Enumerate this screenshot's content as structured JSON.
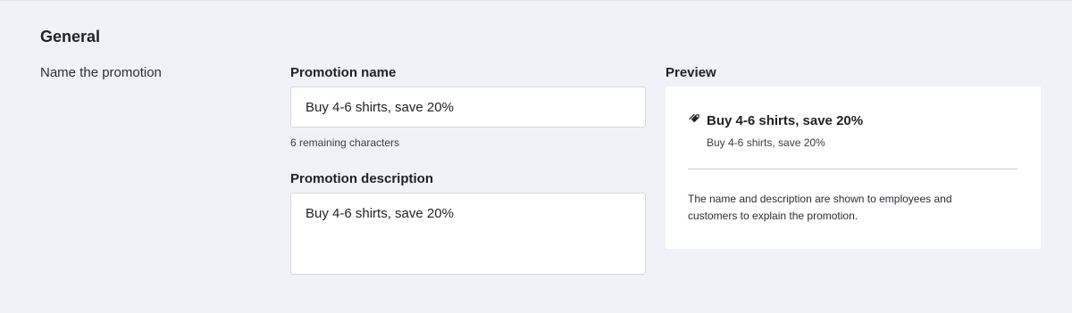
{
  "section": {
    "title": "General",
    "row_label": "Name the promotion"
  },
  "form": {
    "name_label": "Promotion name",
    "name_value": "Buy 4-6 shirts, save 20%",
    "name_helper": "6 remaining characters",
    "description_label": "Promotion description",
    "description_value": "Buy 4-6 shirts, save 20%"
  },
  "preview": {
    "label": "Preview",
    "icon": "tag-icon",
    "title": "Buy 4-6 shirts, save 20%",
    "subtitle": "Buy 4-6 shirts, save 20%",
    "note": "The name and description are shown to employees and customers to explain the promotion."
  }
}
